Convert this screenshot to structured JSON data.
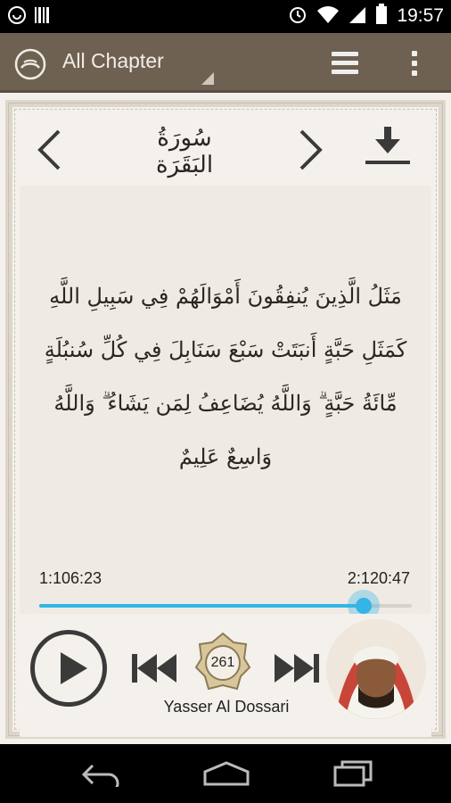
{
  "status_bar": {
    "time": "19:57",
    "icons": [
      "app-notification-icon",
      "barcode-icon",
      "alarm-icon",
      "wifi-icon",
      "signal-icon",
      "battery-icon"
    ]
  },
  "action_bar": {
    "spinner_label": "All Chapter",
    "icons": [
      "quran-logo-icon",
      "list-icon",
      "overflow-menu-icon"
    ]
  },
  "surah": {
    "title": "سُورَةُ البَقَرَة"
  },
  "verse": {
    "text": "مَثَلُ الَّذِينَ يُنفِقُونَ أَمْوَالَهُمْ فِي سَبِيلِ اللَّهِ كَمَثَلِ حَبَّةٍ أَنبَتَتْ سَبْعَ سَنَابِلَ فِي كُلِّ سُنبُلَةٍ مِّائَةُ حَبَّةٍ ۗ وَاللَّهُ يُضَاعِفُ لِمَن يَشَاءُ ۗ وَاللَّهُ وَاسِعٌ عَلِيمٌ"
  },
  "playback": {
    "elapsed": "1:106:23",
    "total": "2:120:47",
    "progress_fraction": 0.87
  },
  "player": {
    "verse_number": "261",
    "reciter_name": "Yasser Al Dossari"
  },
  "colors": {
    "action_bar": "#6e6152",
    "accent": "#33b5e5",
    "background": "#f4f1ec"
  }
}
